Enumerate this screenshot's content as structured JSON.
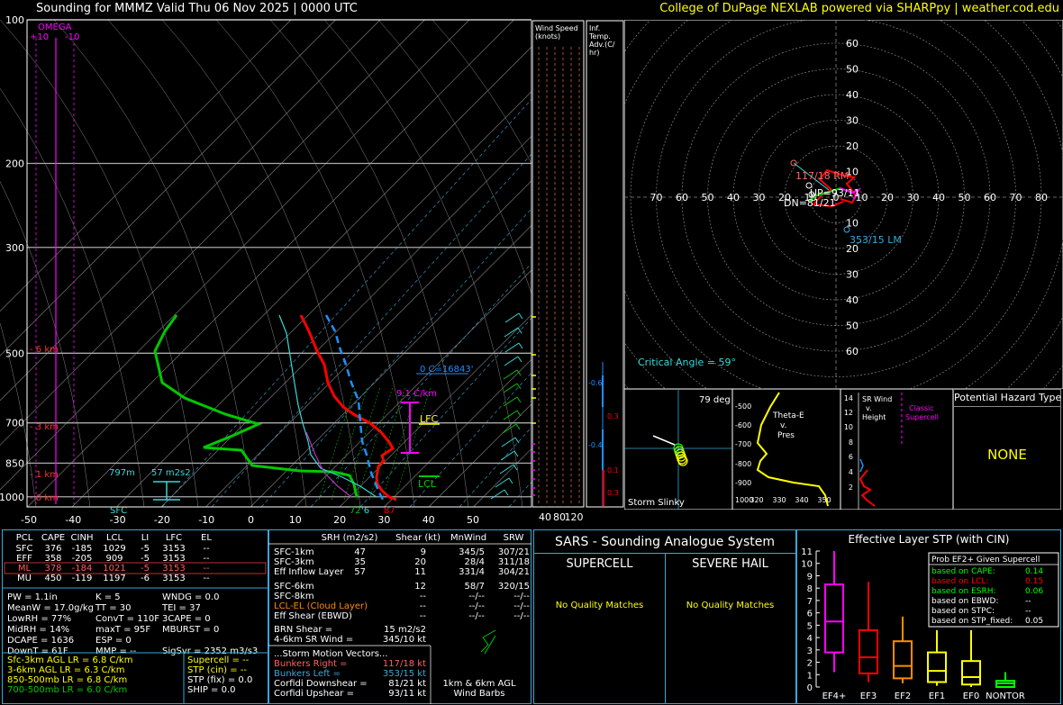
{
  "header": {
    "title": "Sounding for MMMZ Valid  Thu 06 Nov 2025 | 0000 UTC",
    "credit": "College of DuPage NEXLAB powered via SHARPpy | weather.cod.edu"
  },
  "skewt": {
    "omega_label": "OMEGA",
    "omega_ticks": [
      "+10",
      "-10"
    ],
    "pressure_ticks": [
      "100",
      "200",
      "300",
      "500",
      "700",
      "850",
      "1000"
    ],
    "temp_ticks": [
      "-50",
      "-40",
      "-30",
      "-20",
      "-10",
      "0",
      "10",
      "20",
      "30",
      "40",
      "50"
    ],
    "height_labels": [
      "6 km",
      "3 km",
      "1 km",
      "0 km"
    ],
    "annotations": {
      "zero_c": "0 C=16843'",
      "lapse": "9.1 C/km",
      "lfc": "LFC",
      "lcl": "LCL",
      "eff_inflow_left": "797m",
      "eff_inflow_right": "57 m2s2",
      "sfc": "SFC",
      "sfc_t": "72",
      "sfc_td": "'6",
      "sfc_tv": "87"
    }
  },
  "wind_speed": {
    "title": "Wind Speed (knots)",
    "ticks": [
      "40",
      "80",
      "120"
    ]
  },
  "inf_temp": {
    "title": "Inf. Temp. Adv.(C/ hr)",
    "labels": [
      "-0.6",
      "-0.4",
      "0.3",
      "0.1",
      "0.1",
      "0.3"
    ]
  },
  "hodograph": {
    "rings": [
      "10",
      "20",
      "30",
      "40",
      "50",
      "60"
    ],
    "x_ticks": [
      "70",
      "60",
      "50",
      "40",
      "30",
      "20",
      "10",
      "0",
      "10",
      "20",
      "30",
      "40",
      "50",
      "60",
      "70",
      "80"
    ],
    "labels": {
      "rm": "117/18 RM",
      "up": "UP=93/11",
      "dn": "DN=81/21",
      "lm": "353/15 LM",
      "critical": "Critical Angle = 59°"
    }
  },
  "storm_slinky": {
    "title": "Storm Slinky",
    "angle": "79 deg"
  },
  "theta_e": {
    "title": "Theta-E v. Pres",
    "p_ticks": [
      "-500",
      "-600",
      "-700",
      "-800",
      "-900",
      "1000"
    ],
    "x_ticks": [
      "320",
      "330",
      "340",
      "350"
    ]
  },
  "sr_wind": {
    "title": "SR Wind v. Height",
    "h_ticks": [
      "14",
      "12",
      "10",
      "8",
      "6",
      "4",
      "2"
    ],
    "classic": "Classic Supercell"
  },
  "hazard": {
    "title": "Potential Hazard Type",
    "value": "NONE"
  },
  "parcels": {
    "headers": [
      "PCL",
      "CAPE",
      "CINH",
      "LCL",
      "LI",
      "LFC",
      "EL"
    ],
    "rows": [
      [
        "SFC",
        "376",
        "-185",
        "1029",
        "-5",
        "3153",
        "--"
      ],
      [
        "EFF",
        "358",
        "-205",
        "909",
        "-5",
        "3153",
        "--"
      ],
      [
        "ML",
        "378",
        "-184",
        "1021",
        "-5",
        "3153",
        "--"
      ],
      [
        "MU",
        "450",
        "-119",
        "1197",
        "-6",
        "3153",
        "--"
      ]
    ]
  },
  "indices": {
    "col1": [
      "PW = 1.1in",
      "MeanW = 17.0g/kg",
      "LowRH = 77%",
      "MidRH = 14%",
      "DCAPE = 1636",
      "DownT = 61F"
    ],
    "col2": [
      "K = 5",
      "TT = 30",
      "ConvT = 110F",
      "maxT = 95F",
      "ESP = 0",
      "MMP = --"
    ],
    "col3": [
      "WNDG = 0.0",
      "TEI = 37",
      "3CAPE = 0",
      "MBURST = 0",
      "",
      "SigSvr = 2352 m3/s3"
    ]
  },
  "lapse_rates": [
    "Sfc-3km AGL LR = 6.8 C/km",
    "3-6km AGL LR = 6.3 C/km",
    "850-500mb LR = 6.8 C/km",
    "700-500mb LR = 6.0 C/km"
  ],
  "composite": [
    "Supercell = --",
    "STP (cin) = --",
    "STP (fix) = 0.0",
    "SHIP = 0.0"
  ],
  "kinematics": {
    "headers": [
      "SRH (m2/s2)",
      "Shear (kt)",
      "MnWind",
      "SRW"
    ],
    "rows": [
      [
        "SFC-1km",
        "47",
        "9",
        "345/5",
        "307/21"
      ],
      [
        "SFC-3km",
        "35",
        "20",
        "28/4",
        "311/18"
      ],
      [
        "Eff Inflow Layer",
        "57",
        "11",
        "331/4",
        "304/21"
      ],
      [
        "SFC-6km",
        "",
        "12",
        "58/7",
        "320/15"
      ],
      [
        "SFC-8km",
        "",
        "--",
        "--/--",
        "--/--"
      ],
      [
        "LCL-EL (Cloud Layer)",
        "",
        "--",
        "--/--",
        "--/--"
      ],
      [
        "Eff Shear (EBWD)",
        "",
        "--",
        "--/--",
        "--/--"
      ]
    ],
    "brn_shear": "BRN Shear =",
    "brn_shear_val": "15 m2/s2",
    "sr_wind_46": "4-6km SR Wind =",
    "sr_wind_46_val": "345/10 kt",
    "storm_motion": "...Storm Motion Vectors...",
    "bunkers_right": "Bunkers Right =",
    "bunkers_right_val": "117/18 kt",
    "bunkers_left": "Bunkers Left =",
    "bunkers_left_val": "353/15 kt",
    "corfidi_down": "Corfidi Downshear =",
    "corfidi_down_val": "81/21 kt",
    "corfidi_up": "Corfidi Upshear =",
    "corfidi_up_val": "93/11 kt",
    "barbs_caption_1": "1km & 6km AGL",
    "barbs_caption_2": "Wind Barbs"
  },
  "sars": {
    "title": "SARS - Sounding Analogue System",
    "supercell": "SUPERCELL",
    "severe_hail": "SEVERE HAIL",
    "no_match_1": "No Quality Matches",
    "no_match_2": "No Quality Matches"
  },
  "stp_panel": {
    "title": "Effective Layer STP (with CIN)",
    "prob_title": "Prob EF2+ Given Supercell",
    "prob_rows": [
      [
        "based on CAPE:",
        "0.14"
      ],
      [
        "based on LCL:",
        "0.15"
      ],
      [
        "based on ESRH:",
        "0.06"
      ],
      [
        "based on EBWD:",
        "--"
      ],
      [
        "based on STPC:",
        "--"
      ],
      [
        "based on STP_fixed:",
        "0.05"
      ]
    ],
    "y_ticks": [
      "11",
      "10",
      "9",
      "8",
      "7",
      "6",
      "5",
      "4",
      "3",
      "2",
      "1",
      "0"
    ]
  },
  "chart_data": {
    "type": "box",
    "title": "Effective Layer STP (with CIN)",
    "categories": [
      "EF4+",
      "EF3",
      "EF2",
      "EF1",
      "EF0",
      "NONTOR"
    ],
    "colors": [
      "#ff00ff",
      "#ff0000",
      "#ff8c00",
      "#ffff00",
      "#ffff00",
      "#00ff00"
    ],
    "whisker_low": [
      1.2,
      0.4,
      0.3,
      0.1,
      0.0,
      0.0
    ],
    "q1": [
      2.8,
      1.1,
      0.7,
      0.4,
      0.2,
      0.0
    ],
    "median": [
      5.3,
      2.4,
      1.7,
      1.3,
      0.8,
      0.3
    ],
    "q3": [
      8.3,
      4.6,
      3.7,
      2.8,
      2.1,
      0.5
    ],
    "whisker_high": [
      11.0,
      8.5,
      5.7,
      4.6,
      4.6,
      1.2
    ],
    "ylim": [
      0,
      11
    ]
  }
}
